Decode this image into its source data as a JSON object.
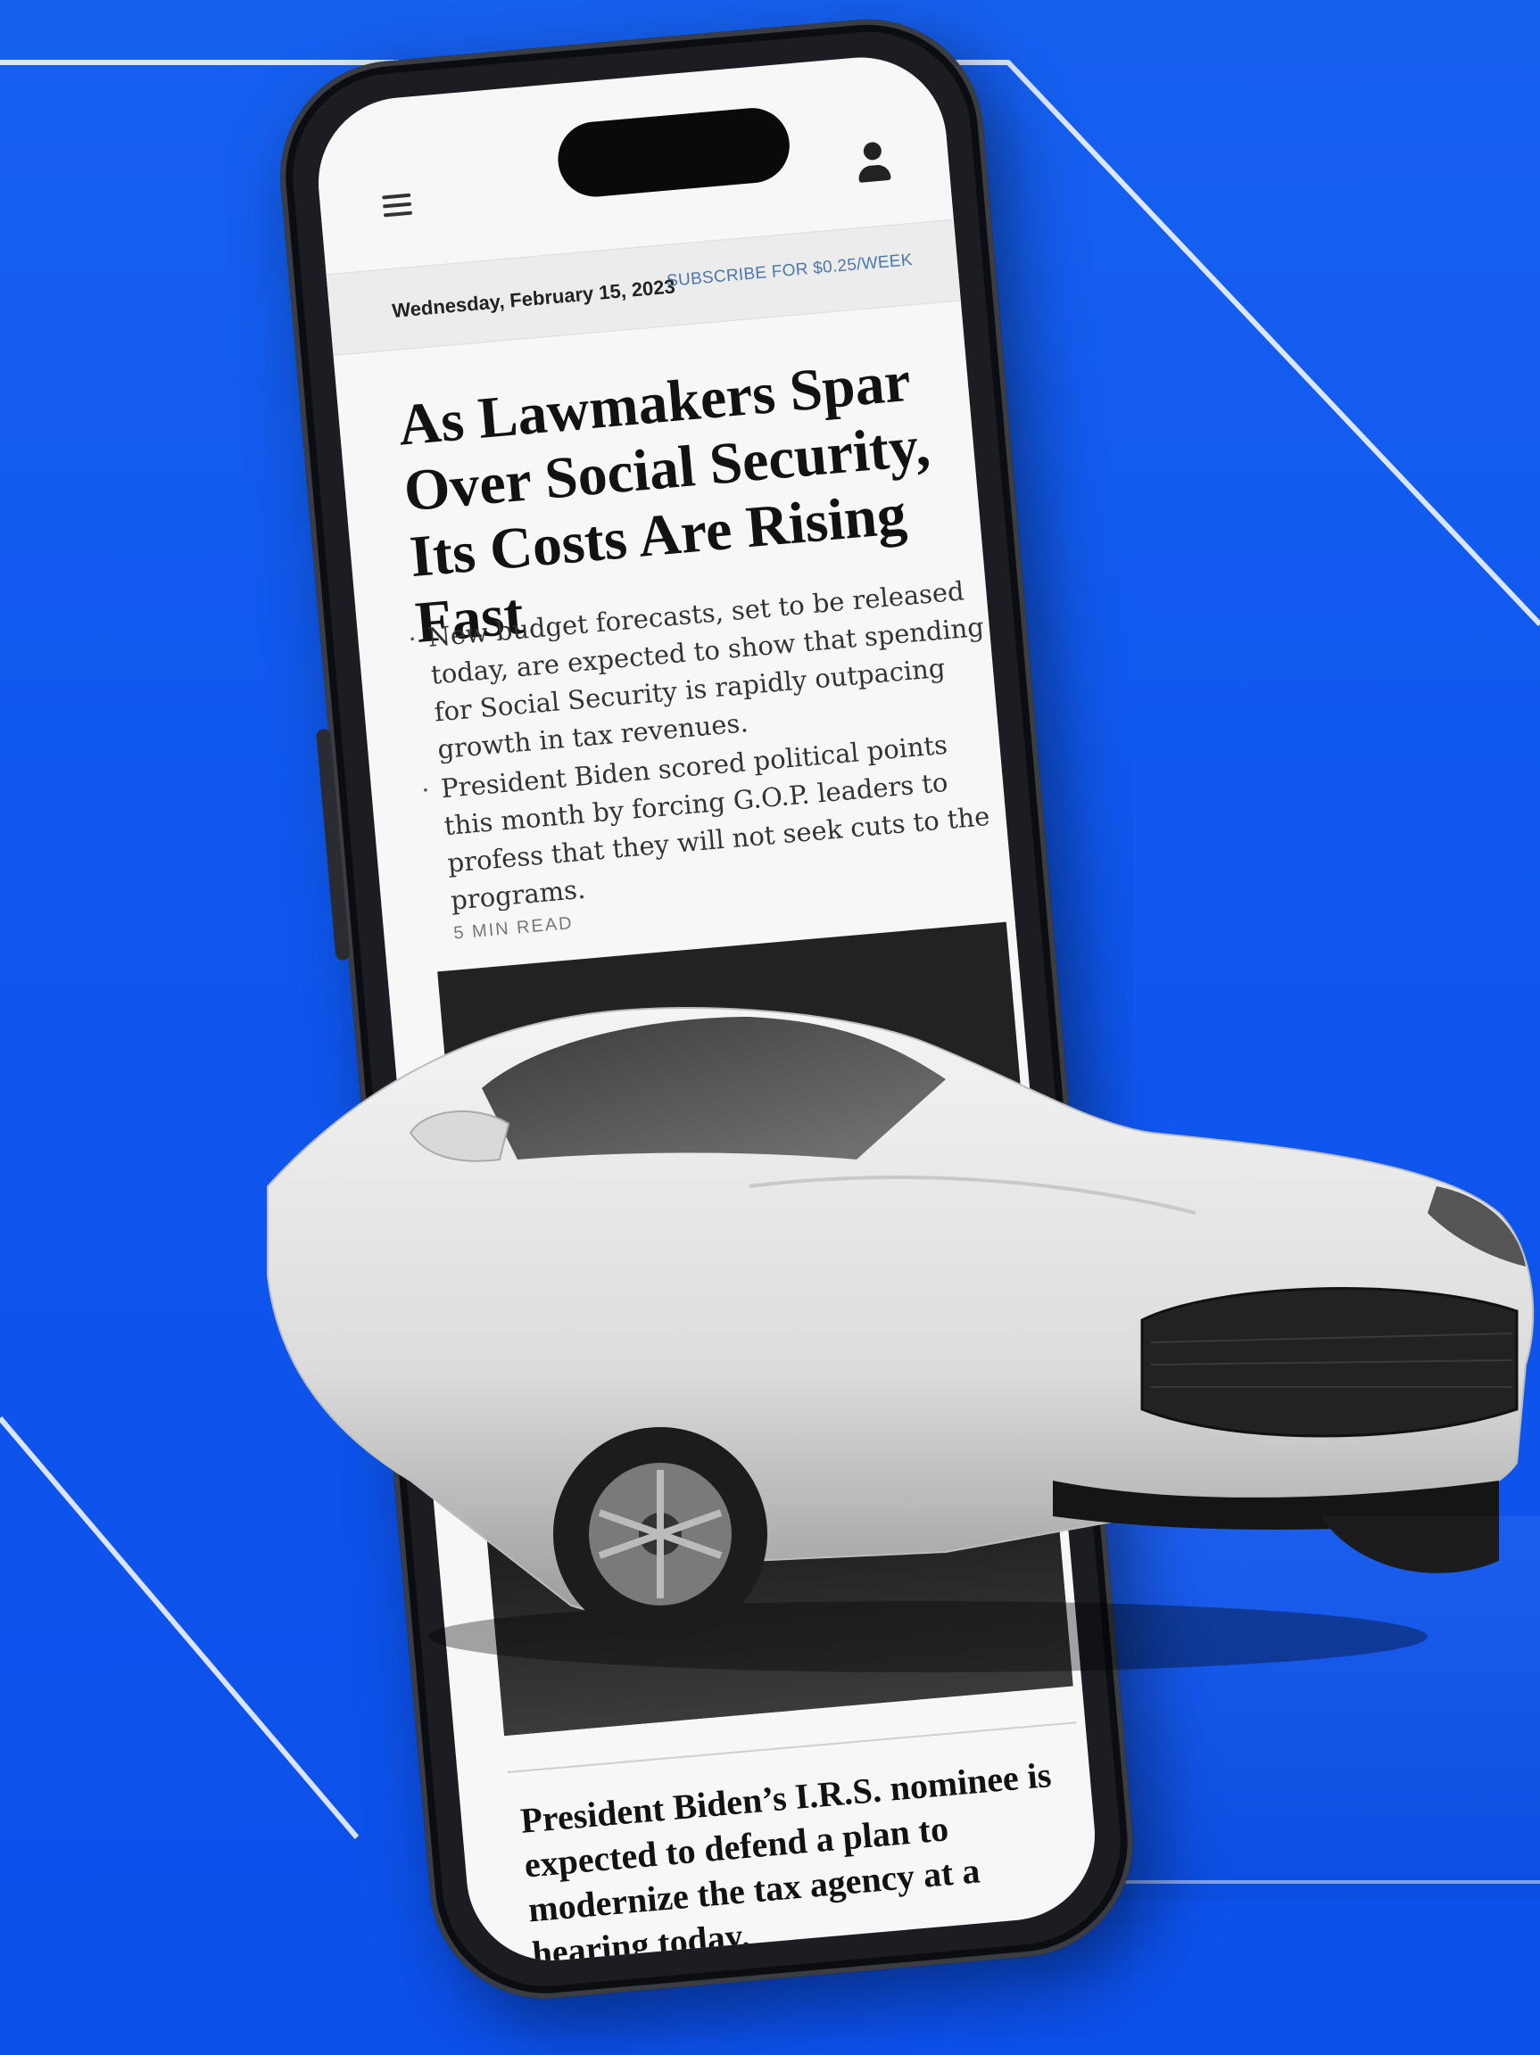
{
  "topbar": {
    "menu_icon": "hamburger-menu-icon",
    "account_icon": "account-icon"
  },
  "dateline": {
    "date": "Wednesday, February 15, 2023",
    "subscribe": "SUBSCRIBE FOR $0.25/WEEK"
  },
  "article": {
    "headline": "As Lawmakers Spar Over Social Security, Its Costs Are Rising Fast",
    "bullets": [
      "New budget forecasts, set to be released today, are expected to show that spending for Social Security is rapidly outpacing growth in tax revenues.",
      "President Biden scored political points this month by forcing G.O.P. leaders to profess that they will not seek cuts to the programs."
    ],
    "read_time": "5 MIN READ"
  },
  "next_story": {
    "headline": "President Biden’s I.R.S. nominee is expected to defend a plan to modernize the tax agency at a hearing today."
  },
  "colors": {
    "background": "#0f57ee",
    "screen": "#f7f7f7",
    "subscribe_link": "#4a78a8"
  }
}
